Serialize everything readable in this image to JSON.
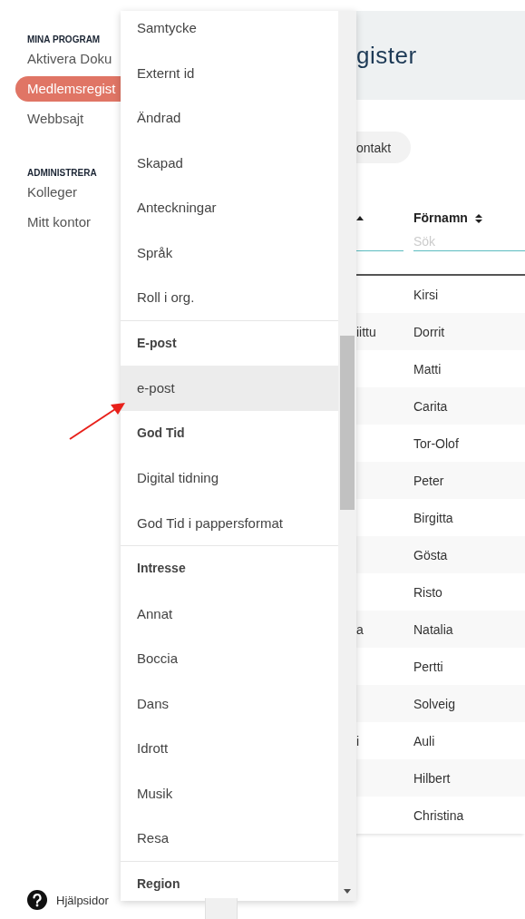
{
  "sidebar": {
    "sections": [
      {
        "heading": "MINA PROGRAM",
        "items": [
          {
            "label": "Aktivera Doku",
            "selected": false
          },
          {
            "label": "Medlemsregist",
            "selected": true
          },
          {
            "label": "Webbsajt",
            "selected": false
          }
        ]
      },
      {
        "heading": "ADMINISTRERA",
        "items": [
          {
            "label": "Kolleger",
            "selected": false
          },
          {
            "label": "Mitt kontor",
            "selected": false
          }
        ]
      }
    ],
    "help_link": "Hjälpsidor"
  },
  "dropdown": {
    "items": [
      {
        "kind": "option",
        "label": "Samtycke",
        "highlighted": false
      },
      {
        "kind": "option",
        "label": "Externt id",
        "highlighted": false
      },
      {
        "kind": "option",
        "label": "Ändrad",
        "highlighted": false
      },
      {
        "kind": "option",
        "label": "Skapad",
        "highlighted": false
      },
      {
        "kind": "option",
        "label": "Anteckningar",
        "highlighted": false
      },
      {
        "kind": "option",
        "label": "Språk",
        "highlighted": false
      },
      {
        "kind": "option",
        "label": "Roll i org.",
        "highlighted": false
      },
      {
        "kind": "divider"
      },
      {
        "kind": "group",
        "label": "E-post"
      },
      {
        "kind": "option",
        "label": "e-post",
        "highlighted": true
      },
      {
        "kind": "group",
        "label": "God Tid"
      },
      {
        "kind": "option",
        "label": "Digital tidning",
        "highlighted": false
      },
      {
        "kind": "option",
        "label": "God Tid i pappersformat",
        "highlighted": false
      },
      {
        "kind": "divider"
      },
      {
        "kind": "group",
        "label": "Intresse"
      },
      {
        "kind": "option",
        "label": "Annat",
        "highlighted": false
      },
      {
        "kind": "option",
        "label": "Boccia",
        "highlighted": false
      },
      {
        "kind": "option",
        "label": "Dans",
        "highlighted": false
      },
      {
        "kind": "option",
        "label": "Idrott",
        "highlighted": false
      },
      {
        "kind": "option",
        "label": "Musik",
        "highlighted": false
      },
      {
        "kind": "option",
        "label": "Resa",
        "highlighted": false
      },
      {
        "kind": "divider"
      },
      {
        "kind": "group",
        "label": "Region"
      }
    ]
  },
  "main": {
    "title": "gister",
    "chip": "ontakt",
    "table": {
      "columns": [
        {
          "sorted": true
        },
        {
          "label": "Förnamn",
          "sorted": false,
          "placeholder": "Sök"
        }
      ],
      "rows": [
        {
          "first_name": "Kirsi"
        },
        {
          "column_1": "iittu",
          "first_name": "Dorrit"
        },
        {
          "first_name": "Matti"
        },
        {
          "first_name": "Carita"
        },
        {
          "first_name": "Tor-Olof"
        },
        {
          "first_name": "Peter"
        },
        {
          "first_name": "Birgitta"
        },
        {
          "first_name": "Gösta"
        },
        {
          "first_name": "Risto"
        },
        {
          "column_1": "a",
          "first_name": "Natalia"
        },
        {
          "first_name": "Pertti"
        },
        {
          "first_name": "Solveig"
        },
        {
          "column_1": "i",
          "first_name": "Auli"
        },
        {
          "first_name": "Hilbert"
        },
        {
          "first_name": "Christina"
        }
      ]
    }
  }
}
